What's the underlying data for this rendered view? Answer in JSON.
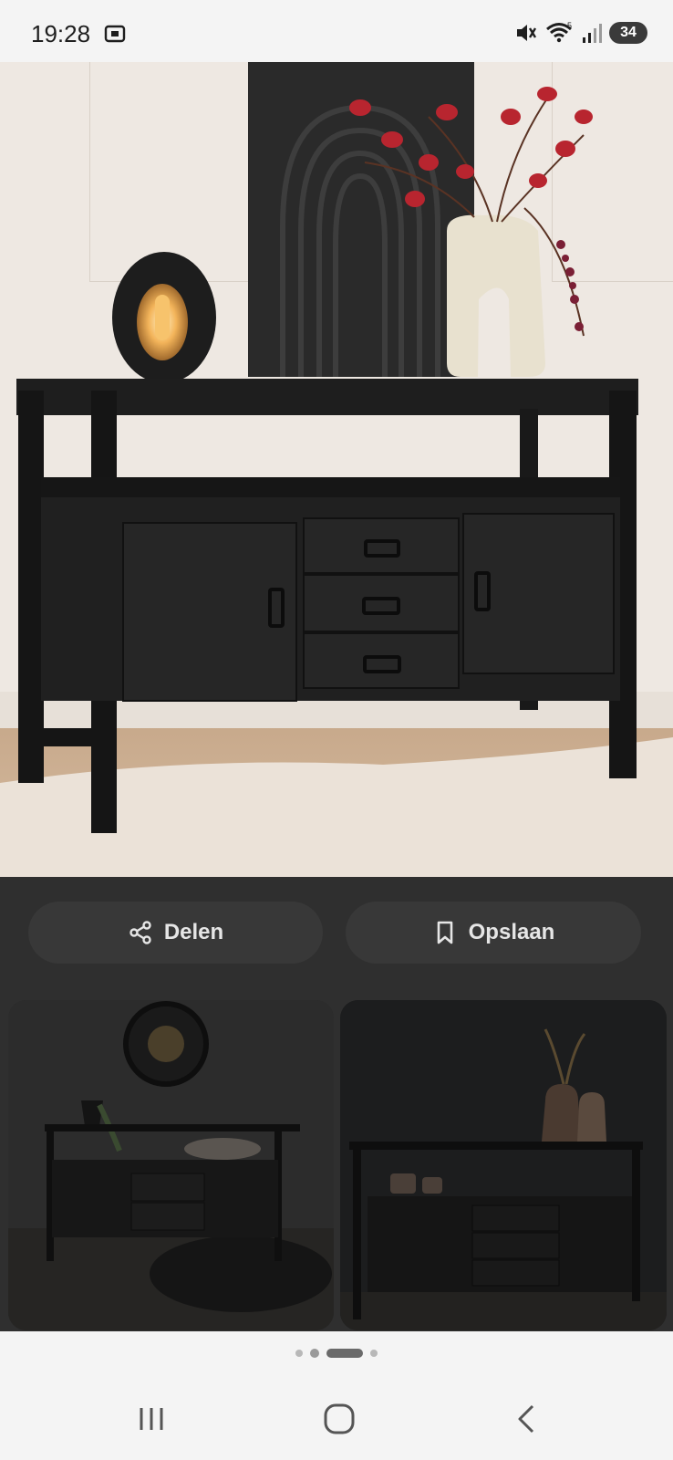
{
  "status_bar": {
    "time": "19:28",
    "battery": "34",
    "icons": [
      "screenshot-icon",
      "mute-icon",
      "wifi-icon",
      "signal-icon"
    ]
  },
  "hero": {
    "description_icons": [
      "sideboard-photo"
    ]
  },
  "actions": {
    "share_label": "Delen",
    "save_label": "Opslaan"
  },
  "pager": {
    "count": 4,
    "active_index": 2
  },
  "colors": {
    "sheet_bg": "#2f2f2f",
    "button_bg": "#383838",
    "button_text": "#e6e6e6",
    "status_bg": "#f4f4f4"
  },
  "nav": {
    "icons": [
      "recent-apps-icon",
      "home-icon",
      "back-icon"
    ]
  }
}
